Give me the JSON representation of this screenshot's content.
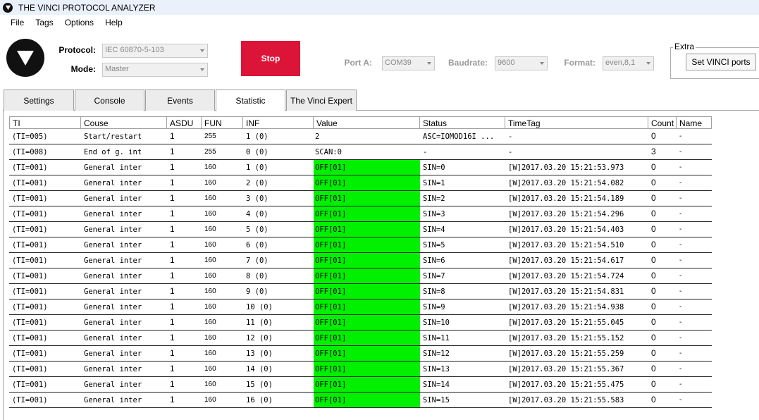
{
  "window": {
    "title": "THE VINCI PROTOCOL ANALYZER"
  },
  "menu": [
    "File",
    "Tags",
    "Options",
    "Help"
  ],
  "settings": {
    "protocol_label": "Protocol:",
    "protocol_value": "IEC 60870-5-103",
    "mode_label": "Mode:",
    "mode_value": "Master",
    "stop_label": "Stop",
    "port_label": "Port A:",
    "port_value": "COM39",
    "baudrate_label": "Baudrate:",
    "baudrate_value": "9600",
    "format_label": "Format:",
    "format_value": "even,8,1",
    "extra_label": "Extra",
    "vinci_ports_label": "Set VINCI ports"
  },
  "tabs": [
    "Settings",
    "Console",
    "Events",
    "Statistic",
    "The Vinci Expert"
  ],
  "active_tab": "Statistic",
  "colors": {
    "stop": "#dc1438",
    "value_highlight": "#00f000"
  },
  "table": {
    "headers": [
      "TI",
      "Couse",
      "ASDU",
      "FUN",
      "INF",
      "Value",
      "Status",
      "TimeTag",
      "Count",
      "Name"
    ],
    "rows": [
      [
        "(TI=005)",
        "Start/restart",
        "1",
        "255",
        "1 (0)",
        "2",
        "ASC=IOMOD16I ...",
        "-",
        "0",
        "-"
      ],
      [
        "(TI=008)",
        "End of g. int",
        "1",
        "255",
        "0 (0)",
        "SCAN:0",
        "-",
        "-",
        "3",
        "-"
      ],
      [
        "(TI=001)",
        "General inter",
        "1",
        "160",
        "1 (0)",
        "OFF[01]",
        "SIN=0",
        "[W]2017.03.20 15:21:53.973",
        "0",
        "-"
      ],
      [
        "(TI=001)",
        "General inter",
        "1",
        "160",
        "2 (0)",
        "OFF[01]",
        "SIN=1",
        "[W]2017.03.20 15:21:54.082",
        "0",
        "-"
      ],
      [
        "(TI=001)",
        "General inter",
        "1",
        "160",
        "3 (0)",
        "OFF[01]",
        "SIN=2",
        "[W]2017.03.20 15:21:54.189",
        "0",
        "-"
      ],
      [
        "(TI=001)",
        "General inter",
        "1",
        "160",
        "4 (0)",
        "OFF[01]",
        "SIN=3",
        "[W]2017.03.20 15:21:54.296",
        "0",
        "-"
      ],
      [
        "(TI=001)",
        "General inter",
        "1",
        "160",
        "5 (0)",
        "OFF[01]",
        "SIN=4",
        "[W]2017.03.20 15:21:54.403",
        "0",
        "-"
      ],
      [
        "(TI=001)",
        "General inter",
        "1",
        "160",
        "6 (0)",
        "OFF[01]",
        "SIN=5",
        "[W]2017.03.20 15:21:54.510",
        "0",
        "-"
      ],
      [
        "(TI=001)",
        "General inter",
        "1",
        "160",
        "7 (0)",
        "OFF[01]",
        "SIN=6",
        "[W]2017.03.20 15:21:54.617",
        "0",
        "-"
      ],
      [
        "(TI=001)",
        "General inter",
        "1",
        "160",
        "8 (0)",
        "OFF[01]",
        "SIN=7",
        "[W]2017.03.20 15:21:54.724",
        "0",
        "-"
      ],
      [
        "(TI=001)",
        "General inter",
        "1",
        "160",
        "9 (0)",
        "OFF[01]",
        "SIN=8",
        "[W]2017.03.20 15:21:54.831",
        "0",
        "-"
      ],
      [
        "(TI=001)",
        "General inter",
        "1",
        "160",
        "10 (0)",
        "OFF[01]",
        "SIN=9",
        "[W]2017.03.20 15:21:54.938",
        "0",
        "-"
      ],
      [
        "(TI=001)",
        "General inter",
        "1",
        "160",
        "11 (0)",
        "OFF[01]",
        "SIN=10",
        "[W]2017.03.20 15:21:55.045",
        "0",
        "-"
      ],
      [
        "(TI=001)",
        "General inter",
        "1",
        "160",
        "12 (0)",
        "OFF[01]",
        "SIN=11",
        "[W]2017.03.20 15:21:55.152",
        "0",
        "-"
      ],
      [
        "(TI=001)",
        "General inter",
        "1",
        "160",
        "13 (0)",
        "OFF[01]",
        "SIN=12",
        "[W]2017.03.20 15:21:55.259",
        "0",
        "-"
      ],
      [
        "(TI=001)",
        "General inter",
        "1",
        "160",
        "14 (0)",
        "OFF[01]",
        "SIN=13",
        "[W]2017.03.20 15:21:55.367",
        "0",
        "-"
      ],
      [
        "(TI=001)",
        "General inter",
        "1",
        "160",
        "15 (0)",
        "OFF[01]",
        "SIN=14",
        "[W]2017.03.20 15:21:55.475",
        "0",
        "-"
      ],
      [
        "(TI=001)",
        "General inter",
        "1",
        "160",
        "16 (0)",
        "OFF[01]",
        "SIN=15",
        "[W]2017.03.20 15:21:55.583",
        "0",
        "-"
      ]
    ]
  }
}
